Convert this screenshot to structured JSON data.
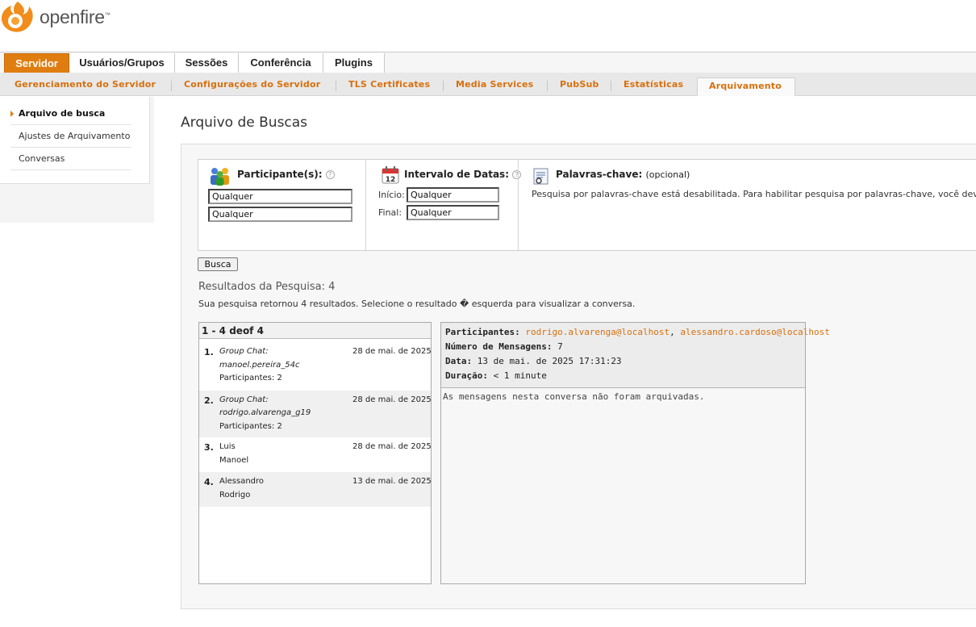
{
  "brand": {
    "name": "openfire",
    "tm": "™"
  },
  "main_tabs": [
    "Servidor",
    "Usuários/Grupos",
    "Sessões",
    "Conferência",
    "Plugins"
  ],
  "sub_tabs": [
    "Gerenciamento do Servidor",
    "Configurações do Servidor",
    "TLS Certificates",
    "Media Services",
    "PubSub",
    "Estatísticas",
    "Arquivamento"
  ],
  "sidebar": [
    {
      "label": "Arquivo de busca",
      "active": true
    },
    {
      "label": "Ajustes de Arquivamento",
      "active": false
    },
    {
      "label": "Conversas",
      "active": false
    }
  ],
  "page_title": "Arquivo de Buscas",
  "search": {
    "participants_label": "Participante(s):",
    "participant1": "Qualquer",
    "participant2": "Qualquer",
    "date_label": "Intervalo de Datas:",
    "calendar_day": "12",
    "start_label": "Início:",
    "start_value": "Qualquer",
    "end_label": "Final:",
    "end_value": "Qualquer",
    "keywords_label": "Palavras-chave:",
    "keywords_optional": "(opcional)",
    "keywords_note": "Pesquisa por palavras-chave está desabilitada. Para habilitar pesquisa por palavras-chave, você dev",
    "help_glyph": "?",
    "button": "Busca"
  },
  "results": {
    "title": "Resultados da Pesquisa: 4",
    "description": "Sua pesquisa retornou 4 resultados. Selecione o resultado � esquerda para visualizar a conversa.",
    "header": "1 - 4 deof 4",
    "rows": [
      {
        "num": "1.",
        "line1": "Group Chat:",
        "line2": "manoel.pereira_54c",
        "line3": "Participantes: 2",
        "date": "28 de mai. de 2025"
      },
      {
        "num": "2.",
        "line1": "Group Chat:",
        "line2": "rodrigo.alvarenga_g19",
        "line3": "Participantes: 2",
        "date": "28 de mai. de 2025"
      },
      {
        "num": "3.",
        "line1": "Luis",
        "line2": "Manoel",
        "line3": "",
        "date": "28 de mai. de 2025"
      },
      {
        "num": "4.",
        "line1": "Alessandro",
        "line2": "Rodrigo",
        "line3": "",
        "date": "13 de mai. de 2025"
      }
    ]
  },
  "detail": {
    "participants_label": "Participantes:",
    "participant_a": "rodrigo.alvarenga@localhost",
    "separator": ",",
    "participant_b": "alessandro.cardoso@localhost",
    "messages_label": "Número de Mensagens:",
    "messages_value": "7",
    "date_label": "Data:",
    "date_value": "13 de mai. de 2025 17:31:23",
    "duration_label": "Duração:",
    "duration_value": "< 1 minute",
    "note": "As mensagens nesta conversa não foram arquivadas."
  },
  "colors": {
    "accent": "#e07d10",
    "link": "#d8700d"
  }
}
